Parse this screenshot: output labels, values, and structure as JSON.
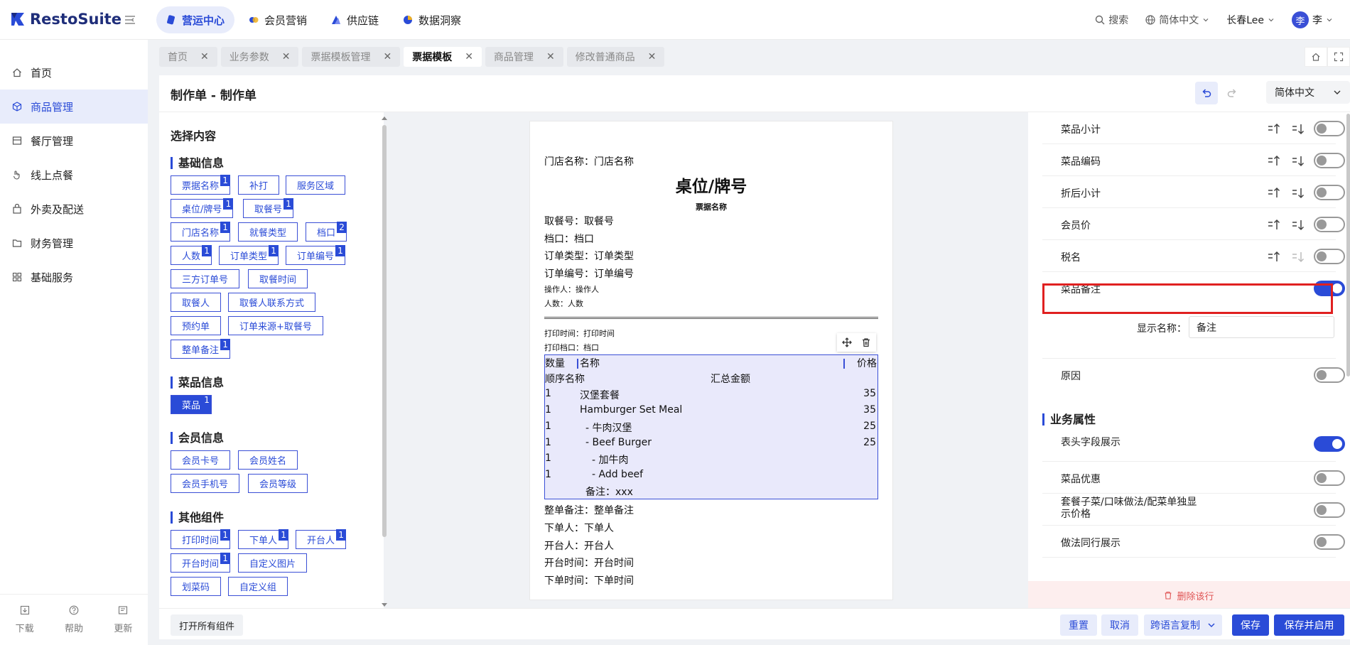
{
  "app": {
    "brand": "RestoSuite"
  },
  "modules": [
    {
      "label": "营运中心",
      "active": true
    },
    {
      "label": "会员营销",
      "active": false
    },
    {
      "label": "供应链",
      "active": false
    },
    {
      "label": "数据洞察",
      "active": false
    }
  ],
  "header_right": {
    "search": "搜索",
    "language": "简体中文",
    "store": "长春Lee",
    "avatar": "李",
    "user": "李"
  },
  "sidebar": {
    "items": [
      {
        "label": "首页",
        "icon": "home-icon"
      },
      {
        "label": "商品管理",
        "icon": "cube-icon",
        "active": true
      },
      {
        "label": "餐厅管理",
        "icon": "store-icon"
      },
      {
        "label": "线上点餐",
        "icon": "hand-icon"
      },
      {
        "label": "外卖及配送",
        "icon": "bag-icon"
      },
      {
        "label": "财务管理",
        "icon": "folder-icon"
      },
      {
        "label": "基础服务",
        "icon": "grid-icon"
      }
    ],
    "footer": [
      {
        "label": "下载",
        "icon": "download-icon"
      },
      {
        "label": "帮助",
        "icon": "help-icon"
      },
      {
        "label": "更新",
        "icon": "update-icon"
      }
    ]
  },
  "tabs": [
    {
      "label": "首页"
    },
    {
      "label": "业务参数"
    },
    {
      "label": "票据模板管理"
    },
    {
      "label": "票据模板",
      "active": true
    },
    {
      "label": "商品管理"
    },
    {
      "label": "修改普通商品"
    }
  ],
  "page": {
    "title": "制作单 - 制作单",
    "language": "简体中文"
  },
  "components": {
    "title": "选择内容",
    "groups": [
      {
        "title": "基础信息",
        "chips": [
          {
            "label": "票据名称",
            "badge": "1"
          },
          {
            "label": "补打"
          },
          {
            "label": "服务区域"
          },
          {
            "label": "桌位/牌号",
            "badge": "1"
          },
          {
            "label": "取餐号",
            "badge": "1"
          },
          {
            "label": "门店名称",
            "badge": "1"
          },
          {
            "label": "就餐类型"
          },
          {
            "label": "档口",
            "badge": "2"
          },
          {
            "label": "人数",
            "badge": "1"
          },
          {
            "label": "订单类型",
            "badge": "1"
          },
          {
            "label": "订单编号",
            "badge": "1"
          },
          {
            "label": "三方订单号"
          },
          {
            "label": "取餐时间"
          },
          {
            "label": "取餐人"
          },
          {
            "label": "取餐人联系方式"
          },
          {
            "label": "预约单"
          },
          {
            "label": "订单来源+取餐号"
          },
          {
            "label": "整单备注",
            "badge": "1"
          }
        ]
      },
      {
        "title": "菜品信息",
        "chips": [
          {
            "label": "菜品",
            "badge": "1"
          }
        ]
      },
      {
        "title": "会员信息",
        "chips": [
          {
            "label": "会员卡号"
          },
          {
            "label": "会员姓名"
          },
          {
            "label": "会员手机号"
          },
          {
            "label": "会员等级"
          }
        ]
      },
      {
        "title": "其他组件",
        "chips": [
          {
            "label": "打印时间",
            "badge": "1"
          },
          {
            "label": "下单人",
            "badge": "1"
          },
          {
            "label": "开台人",
            "badge": "1"
          },
          {
            "label": "开台时间",
            "badge": "1"
          },
          {
            "label": "自定义图片"
          },
          {
            "label": "划菜码"
          },
          {
            "label": "自定义组"
          }
        ]
      }
    ]
  },
  "receipt": {
    "store": "门店名称：门店名称",
    "title": "桌位/牌号",
    "subtitle": "票据名称",
    "lines_top": [
      "取餐号：取餐号",
      "档口：档口",
      "订单类型：订单类型",
      "订单编号：订单编号"
    ],
    "lines_small": [
      "操作人：操作人",
      "人数：人数"
    ],
    "print_lines": [
      "打印时间：打印时间",
      "打印档口：档口"
    ],
    "table": {
      "headers": [
        "数量",
        "名称",
        "价格"
      ],
      "subheader": [
        "顺序名称",
        "汇总金额"
      ],
      "rows": [
        {
          "qty": "1",
          "name": "汉堡套餐",
          "price": "35",
          "indent": 0
        },
        {
          "qty": "1",
          "name": "Hamburger Set Meal",
          "price": "35",
          "indent": 0
        },
        {
          "qty": "1",
          "name": "- 牛肉汉堡",
          "price": "25",
          "indent": 1
        },
        {
          "qty": "1",
          "name": "- Beef Burger",
          "price": "25",
          "indent": 1
        },
        {
          "qty": "1",
          "name": "- 加牛肉",
          "price": "",
          "indent": 2
        },
        {
          "qty": "1",
          "name": "- Add beef",
          "price": "",
          "indent": 2
        }
      ],
      "note": "备注：xxx"
    },
    "lines_bottom": [
      "整单备注：整单备注",
      "下单人：下单人",
      "开台人：开台人",
      "开台时间：开台时间",
      "下单时间：下单时间"
    ]
  },
  "settings": {
    "rows": [
      {
        "label": "菜品小计",
        "sortable": true,
        "on": false
      },
      {
        "label": "菜品编码",
        "sortable": true,
        "on": false
      },
      {
        "label": "折后小计",
        "sortable": true,
        "on": false
      },
      {
        "label": "会员价",
        "sortable": true,
        "on": false
      },
      {
        "label": "税名",
        "sortable": true,
        "down_disabled": true,
        "on": false
      },
      {
        "label": "菜品备注",
        "sortable": false,
        "on": true
      }
    ],
    "display_name_label": "显示名称：",
    "display_name_value": "备注",
    "reason": {
      "label": "原因",
      "on": false
    },
    "business_title": "业务属性",
    "business_rows": [
      {
        "label": "表头字段展示",
        "on": true
      },
      {
        "label": "菜品优惠",
        "on": false
      },
      {
        "label": "套餐子菜/口味做法/配菜单独显示价格",
        "on": false
      },
      {
        "label": "做法同行展示",
        "on": false
      }
    ],
    "delete_label": "删除该行"
  },
  "bottom": {
    "open_all": "打开所有组件",
    "reset": "重置",
    "cancel": "取消",
    "copy_lang": "跨语言复制",
    "save": "保存",
    "save_enable": "保存并启用"
  },
  "colors": {
    "primary": "#2a4bd7",
    "highlight": "#e02020",
    "table_bg": "#e9e9fb"
  }
}
